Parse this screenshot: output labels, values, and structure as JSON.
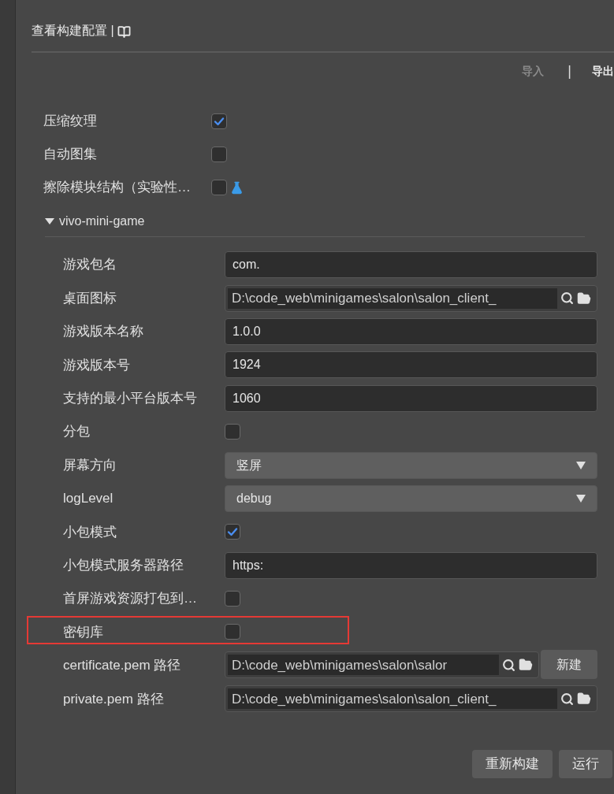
{
  "header": {
    "title": "查看构建配置 |"
  },
  "toolbar": {
    "import": "导入",
    "separator": "|",
    "export": "导出"
  },
  "general_rows": [
    {
      "label": "压缩纹理",
      "checked": true,
      "experimental": false
    },
    {
      "label": "自动图集",
      "checked": false,
      "experimental": false
    },
    {
      "label": "擦除模块结构（实验性…",
      "checked": false,
      "experimental": true
    }
  ],
  "section": {
    "title": "vivo-mini-game",
    "expanded": true
  },
  "rows": [
    {
      "kind": "text",
      "label": "游戏包名",
      "value": "com."
    },
    {
      "kind": "path",
      "label": "桌面图标",
      "value": "D:\\code_web\\minigames\\salon\\salon_client_"
    },
    {
      "kind": "text",
      "label": "游戏版本名称",
      "value": "1.0.0"
    },
    {
      "kind": "text",
      "label": "游戏版本号",
      "value": "1924"
    },
    {
      "kind": "text",
      "label": "支持的最小平台版本号",
      "value": "1060"
    },
    {
      "kind": "checkbox",
      "label": "分包",
      "checked": false
    },
    {
      "kind": "select",
      "label": "屏幕方向",
      "value": "竖屏"
    },
    {
      "kind": "select",
      "label": "logLevel",
      "value": "debug"
    },
    {
      "kind": "checkbox",
      "label": "小包模式",
      "checked": true
    },
    {
      "kind": "text",
      "label": "小包模式服务器路径",
      "value": "https:"
    },
    {
      "kind": "checkbox",
      "label": "首屏游戏资源打包到…",
      "checked": false
    },
    {
      "kind": "checkbox",
      "label": "密钥库",
      "checked": false,
      "highlighted": true
    },
    {
      "kind": "path",
      "label": "certificate.pem 路径",
      "value": "D:\\code_web\\minigames\\salon\\salor",
      "button": "新建"
    },
    {
      "kind": "path",
      "label": "private.pem 路径",
      "value": "D:\\code_web\\minigames\\salon\\salon_client_"
    }
  ],
  "buttons": [
    "重新构建",
    "运行"
  ]
}
